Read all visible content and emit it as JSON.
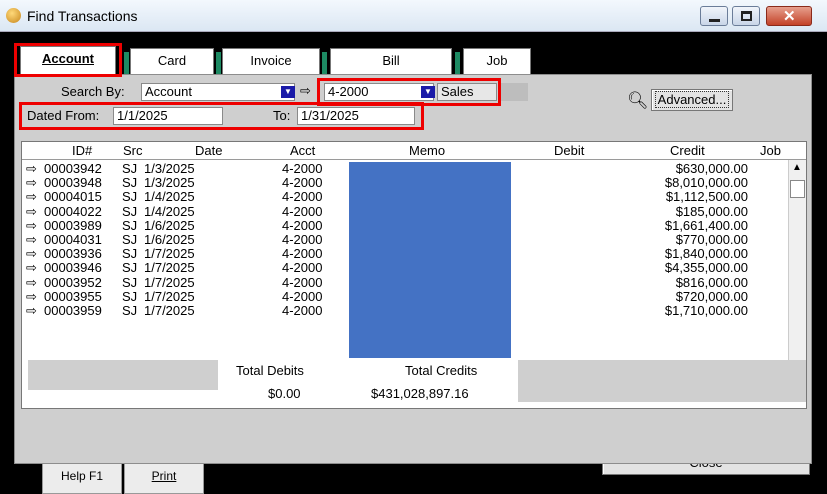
{
  "window": {
    "title": "Find Transactions"
  },
  "tabs": [
    {
      "label": "Account"
    },
    {
      "label": "Card"
    },
    {
      "label": "Invoice"
    },
    {
      "label": "Bill"
    },
    {
      "label": "Job"
    }
  ],
  "search": {
    "search_by_label": "Search By:",
    "search_by_value": "Account",
    "account_value": "4-2000",
    "account_name": "Sales",
    "dated_from_label": "Dated From:",
    "dated_from_value": "1/1/2025",
    "to_label": "To:",
    "to_value": "1/31/2025",
    "advanced_label": "Advanced..."
  },
  "table": {
    "columns": [
      "ID#",
      "Src",
      "Date",
      "Acct",
      "Memo",
      "Debit",
      "Credit",
      "Job"
    ],
    "rows": [
      {
        "id": "00003942",
        "src": "SJ",
        "date": "1/3/2025",
        "acct": "4-2000",
        "credit": "$630,000.00"
      },
      {
        "id": "00003948",
        "src": "SJ",
        "date": "1/3/2025",
        "acct": "4-2000",
        "credit": "$8,010,000.00"
      },
      {
        "id": "00004015",
        "src": "SJ",
        "date": "1/4/2025",
        "acct": "4-2000",
        "credit": "$1,112,500.00"
      },
      {
        "id": "00004022",
        "src": "SJ",
        "date": "1/4/2025",
        "acct": "4-2000",
        "credit": "$185,000.00"
      },
      {
        "id": "00003989",
        "src": "SJ",
        "date": "1/6/2025",
        "acct": "4-2000",
        "credit": "$1,661,400.00"
      },
      {
        "id": "00004031",
        "src": "SJ",
        "date": "1/6/2025",
        "acct": "4-2000",
        "credit": "$770,000.00"
      },
      {
        "id": "00003936",
        "src": "SJ",
        "date": "1/7/2025",
        "acct": "4-2000",
        "credit": "$1,840,000.00"
      },
      {
        "id": "00003946",
        "src": "SJ",
        "date": "1/7/2025",
        "acct": "4-2000",
        "credit": "$4,355,000.00"
      },
      {
        "id": "00003952",
        "src": "SJ",
        "date": "1/7/2025",
        "acct": "4-2000",
        "credit": "$816,000.00"
      },
      {
        "id": "00003955",
        "src": "SJ",
        "date": "1/7/2025",
        "acct": "4-2000",
        "credit": "$720,000.00"
      },
      {
        "id": "00003959",
        "src": "SJ",
        "date": "1/7/2025",
        "acct": "4-2000",
        "credit": "$1,710,000.00"
      }
    ]
  },
  "totals": {
    "debits_label": "Total Debits",
    "debits_value": "$0.00",
    "credits_label": "Total Credits",
    "credits_value": "$431,028,897.16"
  },
  "toolbar": {
    "help_label": "Help F1",
    "print_label": "Print",
    "close_label": "Close"
  },
  "colors": {
    "highlight": "#e00000",
    "memo_redaction": "#4472c4",
    "tab_separator": "#1d8a63"
  },
  "icons": {
    "row_arrow": "arrow-right-icon",
    "search": "magnifier-icon",
    "help": "question-mark-icon",
    "print": "printer-icon"
  }
}
